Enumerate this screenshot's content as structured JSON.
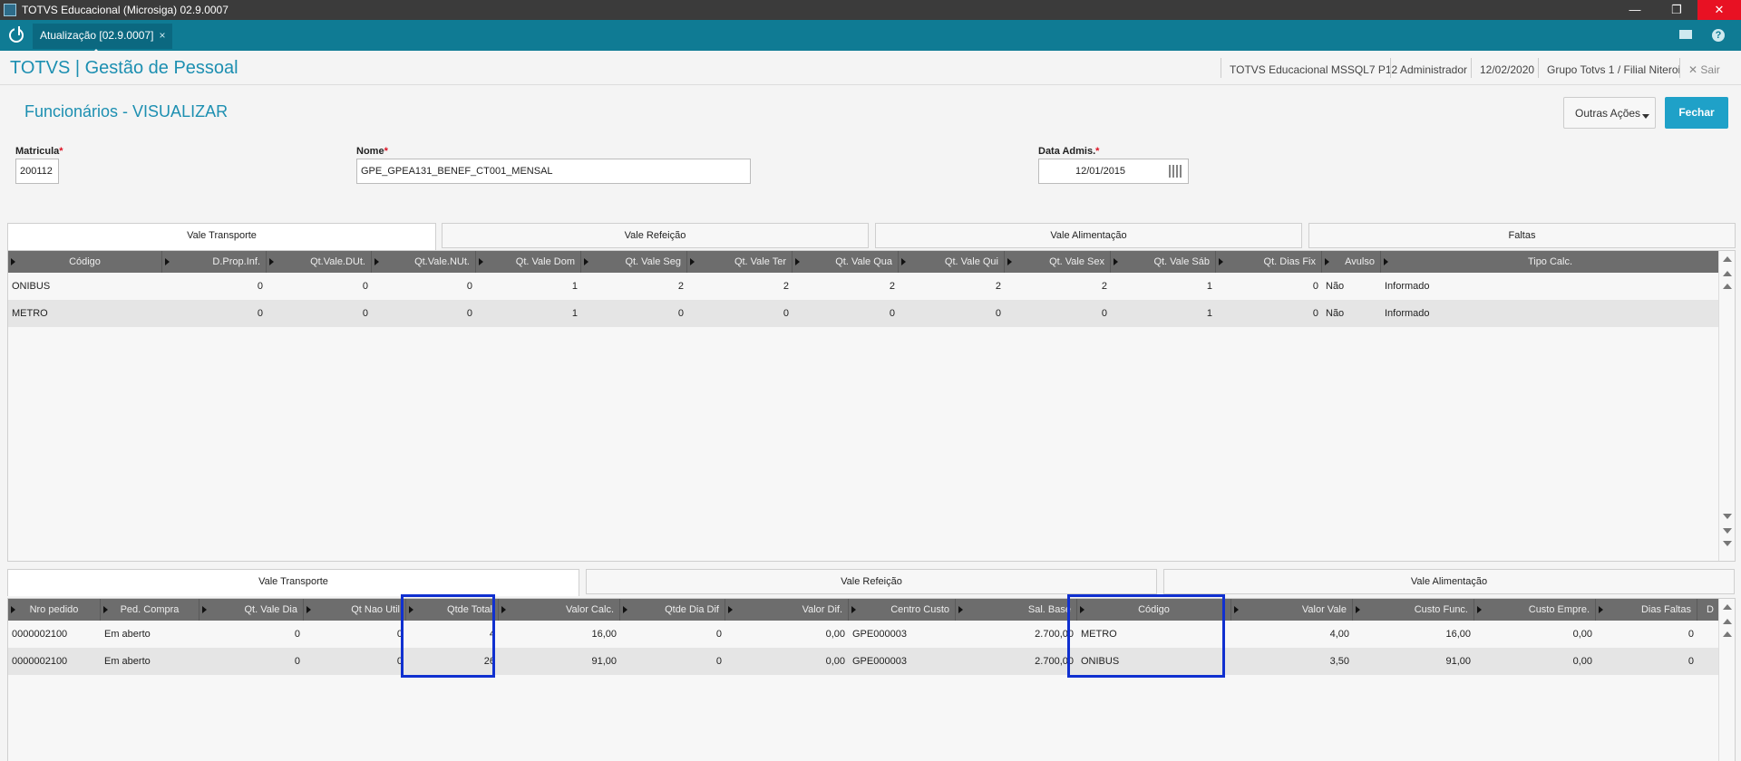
{
  "window": {
    "title": "TOTVS Educacional (Microsiga) 02.9.0007",
    "min": "—",
    "max": "❐",
    "close": "✕"
  },
  "tabbar": {
    "tab_label": "Atualização [02.9.0007]",
    "tab_close": "×",
    "help": "?"
  },
  "header": {
    "brand": "TOTVS | Gestão de Pessoal",
    "environment": "TOTVS Educacional MSSQL7 P12",
    "user": "Administrador",
    "date": "12/02/2020",
    "company": "Grupo Totvs 1 / Filial Niteroi",
    "logout": "✕  Sair"
  },
  "page": {
    "title": "Funcionários - VISUALIZAR",
    "other_actions": "Outras Ações",
    "close": "Fechar"
  },
  "fields": {
    "matricula": {
      "label": "Matricula",
      "required": "*",
      "value": "200112"
    },
    "nome": {
      "label": "Nome",
      "required": "*",
      "value": "GPE_GPEA131_BENEF_CT001_MENSAL"
    },
    "data_admis": {
      "label": "Data Admis.",
      "required": "*",
      "value": "12/01/2015"
    }
  },
  "top_tabs": [
    "Vale Transporte",
    "Vale Refeição",
    "Vale Alimentação",
    "Faltas"
  ],
  "top_grid": {
    "columns": [
      "Código",
      "D.Prop.Inf.",
      "Qt.Vale.DUt.",
      "Qt.Vale.NUt.",
      "Qt. Vale Dom",
      "Qt. Vale Seg",
      "Qt. Vale Ter",
      "Qt. Vale Qua",
      "Qt. Vale Qui",
      "Qt. Vale Sex",
      "Qt. Vale Sáb",
      "Qt. Dias Fix",
      "Avulso",
      "Tipo Calc."
    ],
    "rows": [
      [
        "ONIBUS",
        "0",
        "0",
        "0",
        "1",
        "2",
        "2",
        "2",
        "2",
        "2",
        "1",
        "0",
        "Não",
        "Informado"
      ],
      [
        "METRO",
        "0",
        "0",
        "0",
        "1",
        "0",
        "0",
        "0",
        "0",
        "0",
        "1",
        "0",
        "Não",
        "Informado"
      ]
    ]
  },
  "bottom_tabs": [
    "Vale Transporte",
    "Vale Refeição",
    "Vale Alimentação"
  ],
  "bottom_grid": {
    "columns": [
      "Nro pedido",
      "Ped. Compra",
      "Qt. Vale Dia",
      "Qt Nao Util",
      "Qtde Total",
      "Valor Calc.",
      "Qtde Dia Dif",
      "Valor Dif.",
      "Centro Custo",
      "Sal. Base",
      "Código",
      "Valor Vale",
      "Custo Func.",
      "Custo Empre.",
      "Dias Faltas",
      "D"
    ],
    "rows": [
      [
        "0000002100",
        "Em aberto",
        "0",
        "0",
        "4",
        "16,00",
        "0",
        "0,00",
        "GPE000003",
        "2.700,00",
        "METRO",
        "4,00",
        "16,00",
        "0,00",
        "0"
      ],
      [
        "0000002100",
        "Em aberto",
        "0",
        "0",
        "26",
        "91,00",
        "0",
        "0,00",
        "GPE000003",
        "2.700,00",
        "ONIBUS",
        "3,50",
        "91,00",
        "0,00",
        "0"
      ]
    ]
  },
  "colors": {
    "brand": "#1c8fb1",
    "tabbar": "#0f7b94",
    "grid_header": "#6d6d6d",
    "highlight": "#1030d0",
    "primary_button": "#1fa1c8"
  }
}
